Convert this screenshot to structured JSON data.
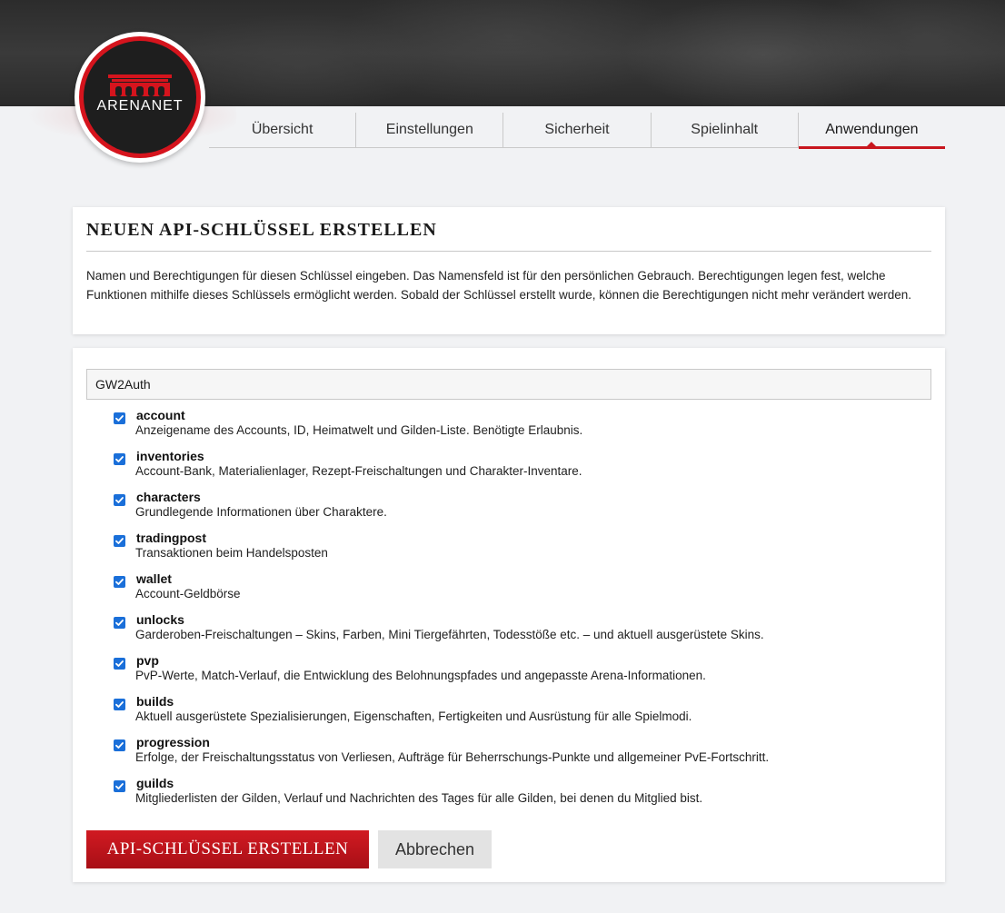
{
  "brand": {
    "logo_text": "ARENANET",
    "accent": "#c8161e"
  },
  "tabs": [
    {
      "label": "Übersicht",
      "active": false
    },
    {
      "label": "Einstellungen",
      "active": false
    },
    {
      "label": "Sicherheit",
      "active": false
    },
    {
      "label": "Spielinhalt",
      "active": false
    },
    {
      "label": "Anwendungen",
      "active": true
    }
  ],
  "intro": {
    "title": "NEUEN API-SCHLÜSSEL ERSTELLEN",
    "text": "Namen und Berechtigungen für diesen Schlüssel eingeben. Das Namensfeld ist für den persönlichen Gebrauch. Berechtigungen legen fest, welche Funktionen mithilfe dieses Schlüssels ermöglicht werden. Sobald der Schlüssel erstellt wurde, können die Berechtigungen nicht mehr verändert werden."
  },
  "form": {
    "key_name_value": "GW2Auth",
    "permissions": [
      {
        "name": "account",
        "checked": true,
        "description": "Anzeigename des Accounts, ID, Heimatwelt und Gilden-Liste. Benötigte Erlaubnis."
      },
      {
        "name": "inventories",
        "checked": true,
        "description": "Account-Bank, Materialienlager, Rezept-Freischaltungen und Charakter-Inventare."
      },
      {
        "name": "characters",
        "checked": true,
        "description": "Grundlegende Informationen über Charaktere."
      },
      {
        "name": "tradingpost",
        "checked": true,
        "description": "Transaktionen beim Handelsposten"
      },
      {
        "name": "wallet",
        "checked": true,
        "description": "Account-Geldbörse"
      },
      {
        "name": "unlocks",
        "checked": true,
        "description": "Garderoben-Freischaltungen – Skins, Farben, Mini Tiergefährten, Todesstöße etc. – und aktuell ausgerüstete Skins."
      },
      {
        "name": "pvp",
        "checked": true,
        "description": "PvP-Werte, Match-Verlauf, die Entwicklung des Belohnungspfades und angepasste Arena-Informationen."
      },
      {
        "name": "builds",
        "checked": true,
        "description": "Aktuell ausgerüstete Spezialisierungen, Eigenschaften, Fertigkeiten und Ausrüstung für alle Spielmodi."
      },
      {
        "name": "progression",
        "checked": true,
        "description": "Erfolge, der Freischaltungsstatus von Verliesen, Aufträge für Beherrschungs-Punkte und allgemeiner PvE-Fortschritt."
      },
      {
        "name": "guilds",
        "checked": true,
        "description": "Mitgliederlisten der Gilden, Verlauf und Nachrichten des Tages für alle Gilden, bei denen du Mitglied bist."
      }
    ],
    "submit_label": "API-SCHLÜSSEL ERSTELLEN",
    "cancel_label": "Abbrechen"
  }
}
